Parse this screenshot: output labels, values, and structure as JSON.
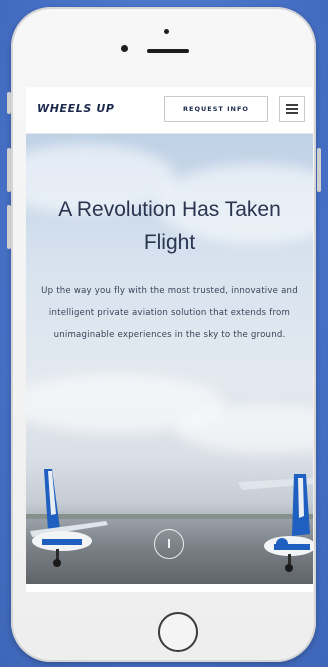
{
  "brand": {
    "logo": "WHEELS UP"
  },
  "navbar": {
    "request_label": "REQUEST INFO",
    "menu_icon": "hamburger-menu-icon"
  },
  "hero": {
    "title": "A Revolution Has Taken Flight",
    "text": "Up the way you fly with the most trusted, innovative and intelligent private aviation solution that extends from unimaginable experiences in the sky to the ground.",
    "scroll_icon": "scroll-down-icon"
  },
  "colors": {
    "background": "#4a74c9",
    "brand_navy": "#1c2a4e",
    "plane_blue": "#1f5fbf"
  }
}
